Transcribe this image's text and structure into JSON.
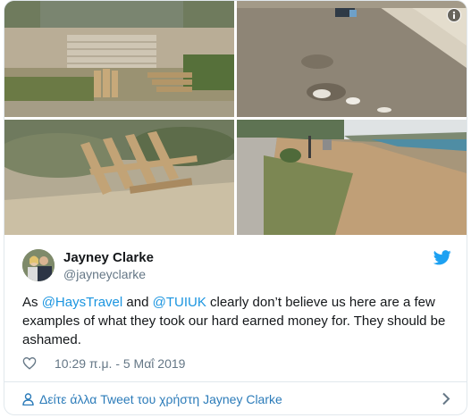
{
  "tweet": {
    "author_name": "Jayney Clarke",
    "author_handle": "@jayneyclarke",
    "text_parts": {
      "p1": "As ",
      "m1": "@HaysTravel",
      "p2": " and ",
      "m2": "@TUIUK",
      "p3": " clearly don’t believe us here are a few examples of what they took our hard earned money for. They should be ashamed."
    },
    "timestamp": "10:29 π.μ. - 5 Μαΐ 2019"
  },
  "footer": {
    "more_tweets_label": "Δείτε άλλα Tweet του χρήστη Jayney Clarke"
  },
  "icons": {
    "info": "info-icon",
    "bird": "twitter-bird-icon",
    "like": "heart-icon",
    "person": "person-icon",
    "chevron": "chevron-right-icon"
  },
  "colors": {
    "link": "#1b95e0",
    "bird": "#1da1f2",
    "muted": "#657786",
    "border": "#e1e8ed"
  }
}
